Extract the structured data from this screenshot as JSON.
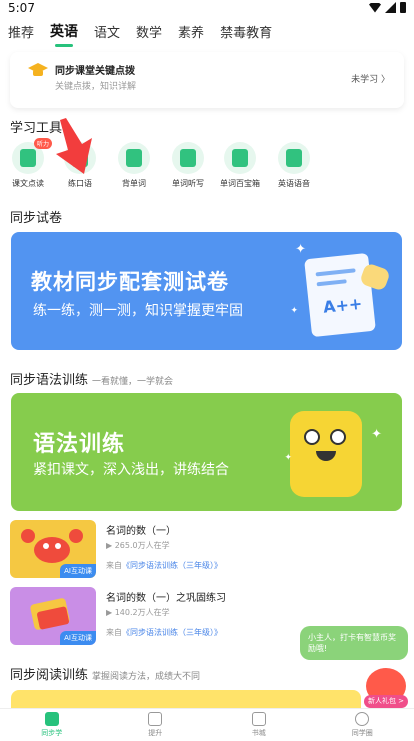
{
  "status_bar": {
    "time": "5:07"
  },
  "tabs": [
    {
      "label": "推荐"
    },
    {
      "label": "英语",
      "active": true
    },
    {
      "label": "语文"
    },
    {
      "label": "数学"
    },
    {
      "label": "素养"
    },
    {
      "label": "禁毒教育"
    }
  ],
  "top_card": {
    "title": "同步课堂关键点拨",
    "subtitle": "关键点拨，知识详解",
    "status": "未学习 〉"
  },
  "tools_section": {
    "title": "学习工具"
  },
  "tools": [
    {
      "label": "课文点读",
      "icon": "book-read-icon",
      "badge": "听力"
    },
    {
      "label": "练口语",
      "icon": "mic-icon"
    },
    {
      "label": "背单词",
      "icon": "word-card-icon"
    },
    {
      "label": "单词听写",
      "icon": "headphone-icon"
    },
    {
      "label": "单词百宝箱",
      "icon": "box-icon"
    },
    {
      "label": "英语语音",
      "icon": "speaker-icon"
    }
  ],
  "sync_test": {
    "section_title": "同步试卷",
    "banner_title": "教材同步配套测试卷",
    "banner_subtitle": "练一练，测一测，知识掌握更牢固",
    "grade": "A++"
  },
  "grammar": {
    "section_title": "同步语法训练",
    "section_subtitle": "一看就懂，一学就会",
    "banner_title": "语法训练",
    "banner_subtitle": "紧扣课文，深入浅出，讲练结合"
  },
  "lessons": [
    {
      "title": "名词的数（一）",
      "learners": "▶ 265.0万人在学",
      "from_prefix": "来自",
      "from_link": "《同步语法训练（三年级）》",
      "tag": "AI互动课",
      "thumb_color": "#f5c842"
    },
    {
      "title": "名词的数（一）之巩固练习",
      "learners": "▶ 140.2万人在学",
      "from_prefix": "来自",
      "from_link": "《同步语法训练（三年级）》",
      "tag": "AI互动课",
      "thumb_color": "#c98ee6"
    }
  ],
  "reading": {
    "section_title": "同步阅读训练",
    "section_subtitle": "掌握阅读方法，成绩大不同"
  },
  "assistant": {
    "bubble": "小主人，打卡有智慧币奖励哦!",
    "gift": "新人礼包 >"
  },
  "bottom_nav": [
    {
      "label": "同步学",
      "icon": "study-icon",
      "active": true
    },
    {
      "label": "提升",
      "icon": "pen-icon"
    },
    {
      "label": "书城",
      "icon": "book-icon"
    },
    {
      "label": "同学圈",
      "icon": "chat-icon"
    }
  ]
}
